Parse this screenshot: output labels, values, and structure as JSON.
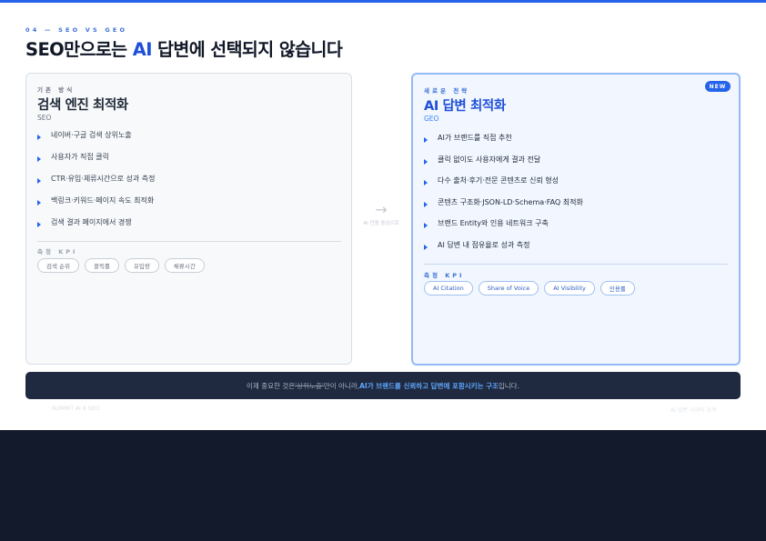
{
  "slide": {
    "eyebrow": "04 — SEO VS GEO",
    "title_part1": "SEO만으로는 ",
    "title_highlight": "AI",
    "title_part2": " 답변에 선택되지 않습니다"
  },
  "left_card": {
    "kicker": "기존 방식",
    "title": "검색 엔진 최적화",
    "subtitle": "SEO",
    "items": [
      "네이버·구글 검색 상위노출",
      "사용자가 직접 클릭",
      "CTR·유입·체류시간으로 성과 측정",
      "백링크·키워드·페이지 속도 최적화",
      "검색 결과 페이지에서 경쟁"
    ],
    "kpi_label": "측정 KPI",
    "kpis": [
      "검색 순위",
      "클릭률",
      "유입량",
      "체류시간"
    ]
  },
  "transition": {
    "arrow": "→",
    "note": "AI 인용 중심으로"
  },
  "right_card": {
    "kicker": "새로운 전략",
    "badge": "NEW",
    "title": "AI 답변 최적화",
    "subtitle": "GEO",
    "items": [
      "AI가 브랜드를 직접 추천",
      "클릭 없이도 사용자에게 결과 전달",
      "다수 출처·후기·전문 콘텐츠로 신뢰 형성",
      "콘텐츠 구조화·JSON-LD·Schema·FAQ 최적화",
      "브랜드 Entity와 인용 네트워크 구축",
      "AI 답변 내 점유율로 성과 측정"
    ],
    "kpi_label": "측정 KPI",
    "kpis": [
      "AI Citation",
      "Share of Voice",
      "AI Visibility",
      "인용률"
    ]
  },
  "banner": {
    "prefix": "이제 중요한 것은 ",
    "struck": "'상위노출'",
    "middle": " 만이 아니라, ",
    "emphasis": "AI가 브랜드를 신뢰하고 답변에 포함시키는 구조",
    "suffix": " 입니다."
  },
  "footer": {
    "left": "SUMMIT AI X GEO",
    "right": "AI 답변 시대의 검색"
  },
  "colors": {
    "accent": "#2563eb",
    "accent_light": "#93bbf5",
    "dark_bg": "#131a2b",
    "banner_bg": "#1f2a40"
  }
}
